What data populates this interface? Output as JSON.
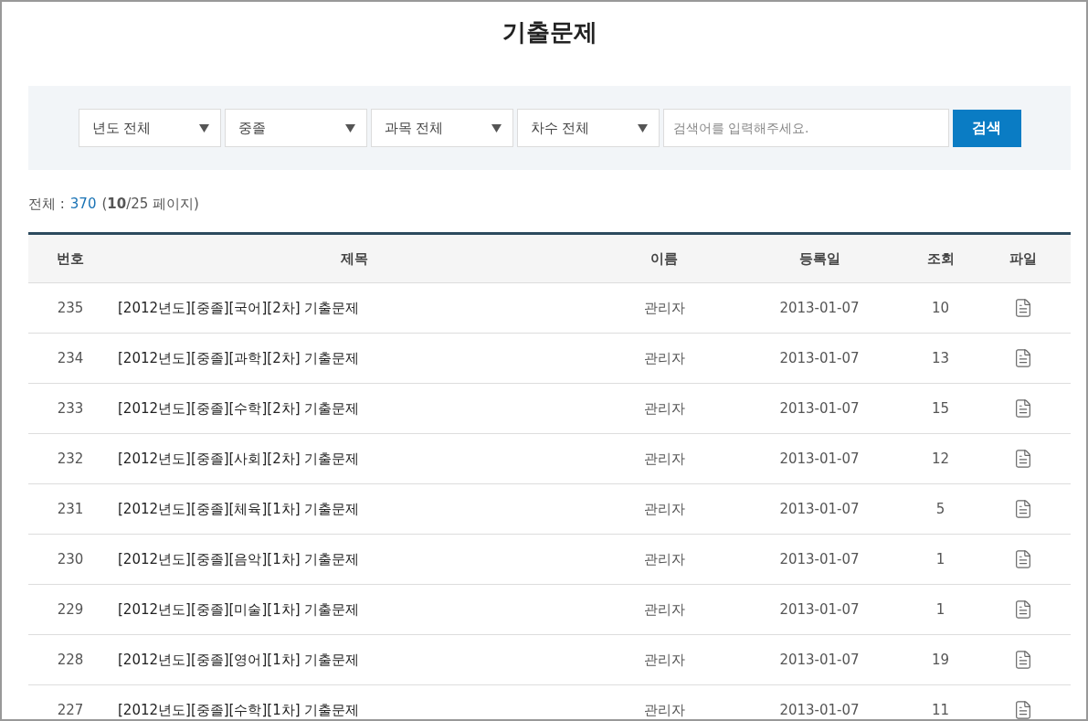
{
  "title": "기출문제",
  "filters": {
    "selects": [
      {
        "label": "년도 전체"
      },
      {
        "label": "중졸"
      },
      {
        "label": "과목 전체"
      },
      {
        "label": "차수 전체"
      }
    ],
    "search": {
      "placeholder": "검색어를 입력해주세요."
    },
    "button": "검색"
  },
  "summary": {
    "label": "전체 :",
    "total": "370",
    "pages": "(**10**/25 페이지)"
  },
  "table": {
    "columns": [
      "번호",
      "제목",
      "이름",
      "등록일",
      "조회",
      "파일"
    ],
    "rows": [
      {
        "no": "235",
        "title": "[2012년도][중졸][국어][2차] 기출문제",
        "name": "관리자",
        "date": "2013-01-07",
        "views": "10"
      },
      {
        "no": "234",
        "title": "[2012년도][중졸][과학][2차] 기출문제",
        "name": "관리자",
        "date": "2013-01-07",
        "views": "13"
      },
      {
        "no": "233",
        "title": "[2012년도][중졸][수학][2차] 기출문제",
        "name": "관리자",
        "date": "2013-01-07",
        "views": "15"
      },
      {
        "no": "232",
        "title": "[2012년도][중졸][사회][2차] 기출문제",
        "name": "관리자",
        "date": "2013-01-07",
        "views": "12"
      },
      {
        "no": "231",
        "title": "[2012년도][중졸][체육][1차] 기출문제",
        "name": "관리자",
        "date": "2013-01-07",
        "views": "5"
      },
      {
        "no": "230",
        "title": "[2012년도][중졸][음악][1차] 기출문제",
        "name": "관리자",
        "date": "2013-01-07",
        "views": "1"
      },
      {
        "no": "229",
        "title": "[2012년도][중졸][미술][1차] 기출문제",
        "name": "관리자",
        "date": "2013-01-07",
        "views": "1"
      },
      {
        "no": "228",
        "title": "[2012년도][중졸][영어][1차] 기출문제",
        "name": "관리자",
        "date": "2013-01-07",
        "views": "19"
      },
      {
        "no": "227",
        "title": "[2012년도][중졸][수학][1차] 기출문제",
        "name": "관리자",
        "date": "2013-01-07",
        "views": "11"
      }
    ]
  }
}
